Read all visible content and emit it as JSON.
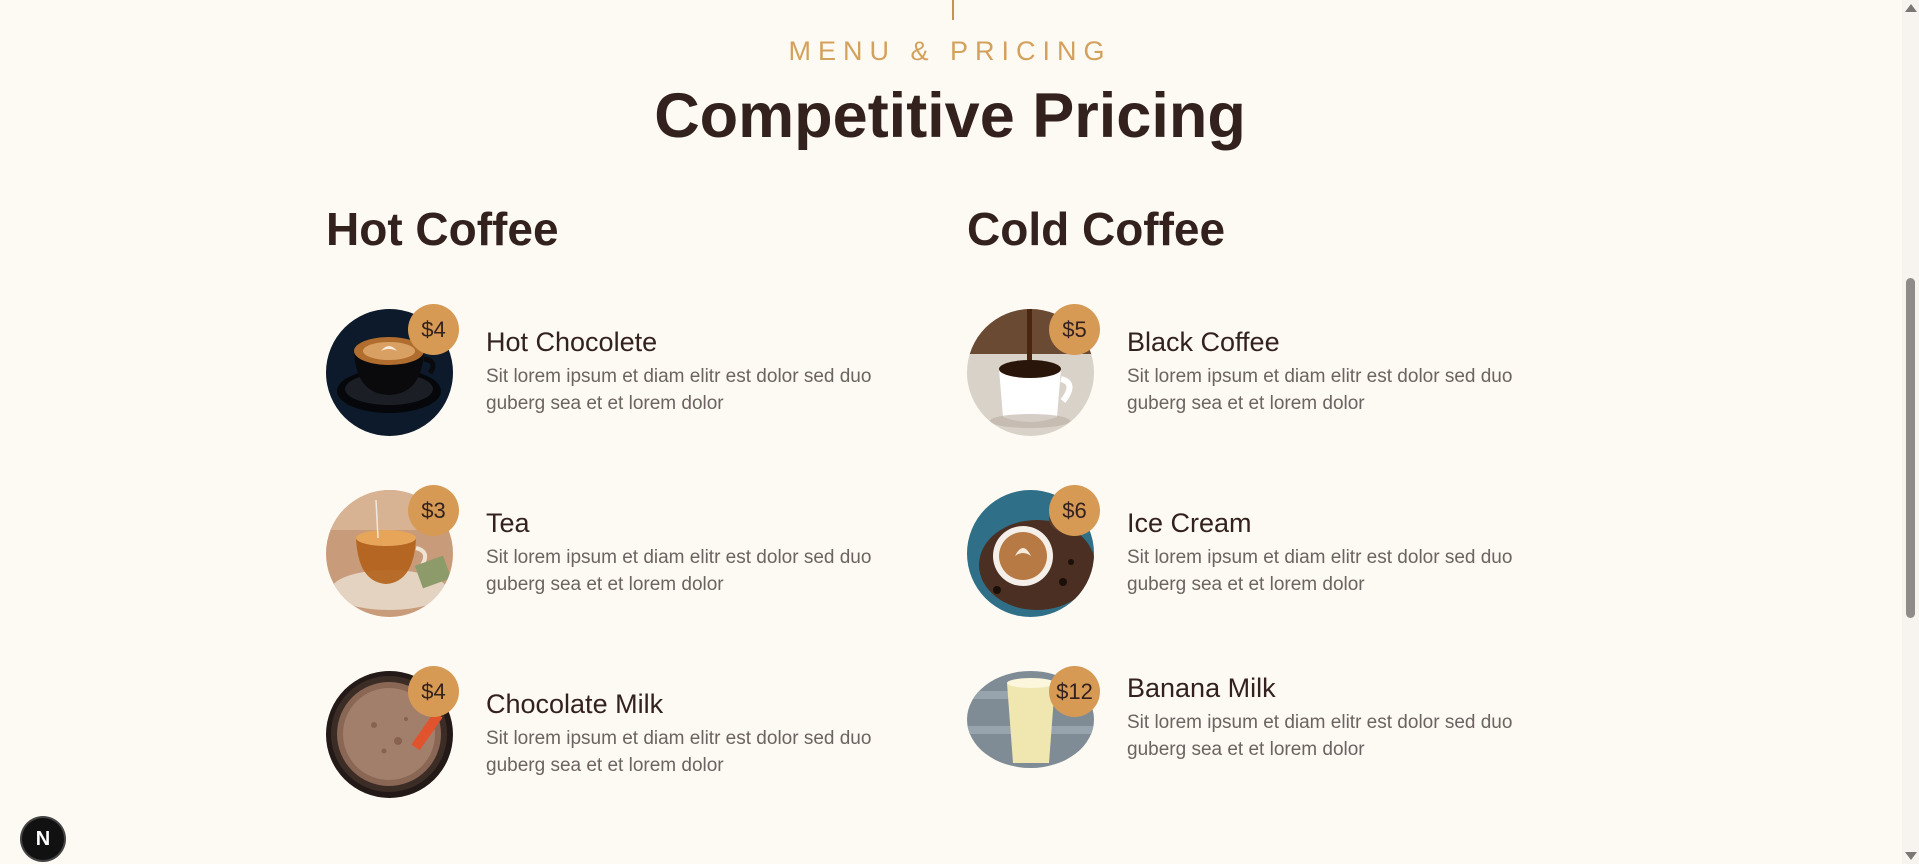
{
  "section": {
    "eyebrow": "MENU & PRICING",
    "title": "Competitive Pricing"
  },
  "menus": {
    "hot": {
      "title": "Hot Coffee",
      "items": [
        {
          "name": "Hot Chocolete",
          "price": "$4",
          "description": "Sit lorem ipsum et diam elitr est dolor sed duo guberg sea et et lorem dolor",
          "image": "latte-art-cup-image"
        },
        {
          "name": "Tea",
          "price": "$3",
          "description": "Sit lorem ipsum et diam elitr est dolor sed duo guberg sea et et lorem dolor",
          "image": "glass-tea-cup-image"
        },
        {
          "name": "Chocolate Milk",
          "price": "$4",
          "description": "Sit lorem ipsum et diam elitr est dolor sed duo guberg sea et et lorem dolor",
          "image": "chocolate-milk-image"
        }
      ]
    },
    "cold": {
      "title": "Cold Coffee",
      "items": [
        {
          "name": "Black Coffee",
          "price": "$5",
          "description": "Sit lorem ipsum et diam elitr est dolor sed duo guberg sea et et lorem dolor",
          "image": "black-coffee-pour-image"
        },
        {
          "name": "Ice Cream",
          "price": "$6",
          "description": "Sit lorem ipsum et diam elitr est dolor sed duo guberg sea et et lorem dolor",
          "image": "latte-beans-image"
        },
        {
          "name": "Banana Milk",
          "price": "$12",
          "description": "Sit lorem ipsum et diam elitr est dolor sed duo guberg sea et et lorem dolor",
          "image": "banana-milk-glass-image"
        }
      ]
    }
  },
  "dev_badge": {
    "label": "N"
  },
  "colors": {
    "background": "#fdf9f3",
    "accent": "#d69a55",
    "heading": "#33211d",
    "body_text": "#6b6460"
  }
}
